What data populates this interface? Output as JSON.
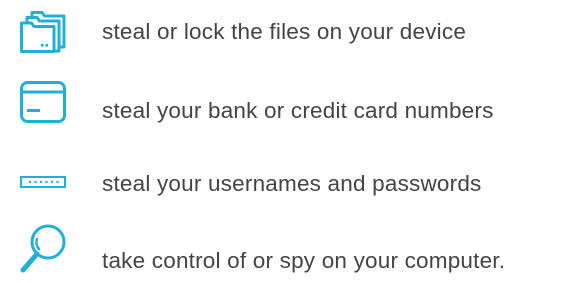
{
  "theme": {
    "icon_color": "#1fb0d8",
    "text_color": "#444444"
  },
  "items": [
    {
      "icon": "folders-icon",
      "label": "steal or lock the files on your device"
    },
    {
      "icon": "credit-card-icon",
      "label": "steal your bank or credit card numbers"
    },
    {
      "icon": "password-field-icon",
      "label": "steal your usernames and passwords"
    },
    {
      "icon": "magnifying-glass-icon",
      "label": "take control of or spy on your computer."
    }
  ]
}
